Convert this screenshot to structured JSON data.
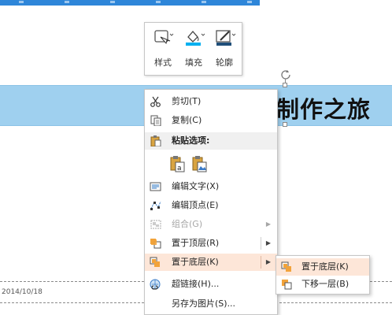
{
  "mini_toolbar": {
    "style_label": "样式",
    "fill_label": "填充",
    "outline_label": "轮廓",
    "fill_color": "#00b0f0",
    "outline_color": "#1f4e79"
  },
  "slide": {
    "title_partial": "制作之旅",
    "banner_color": "#9fd0ef",
    "date": "2014/10/18"
  },
  "context_menu": {
    "cut": "剪切(T)",
    "copy": "复制(C)",
    "paste_options": "粘贴选项:",
    "edit_text": "编辑文字(X)",
    "edit_points": "编辑顶点(E)",
    "group": "组合(G)",
    "bring_to_front": "置于顶层(R)",
    "send_to_back": "置于底层(K)",
    "hyperlink": "超链接(H)...",
    "save_as_picture": "另存为图片(S)..."
  },
  "submenu": {
    "send_to_back": "置于底层(K)",
    "send_backward": "下移一层(B)"
  }
}
